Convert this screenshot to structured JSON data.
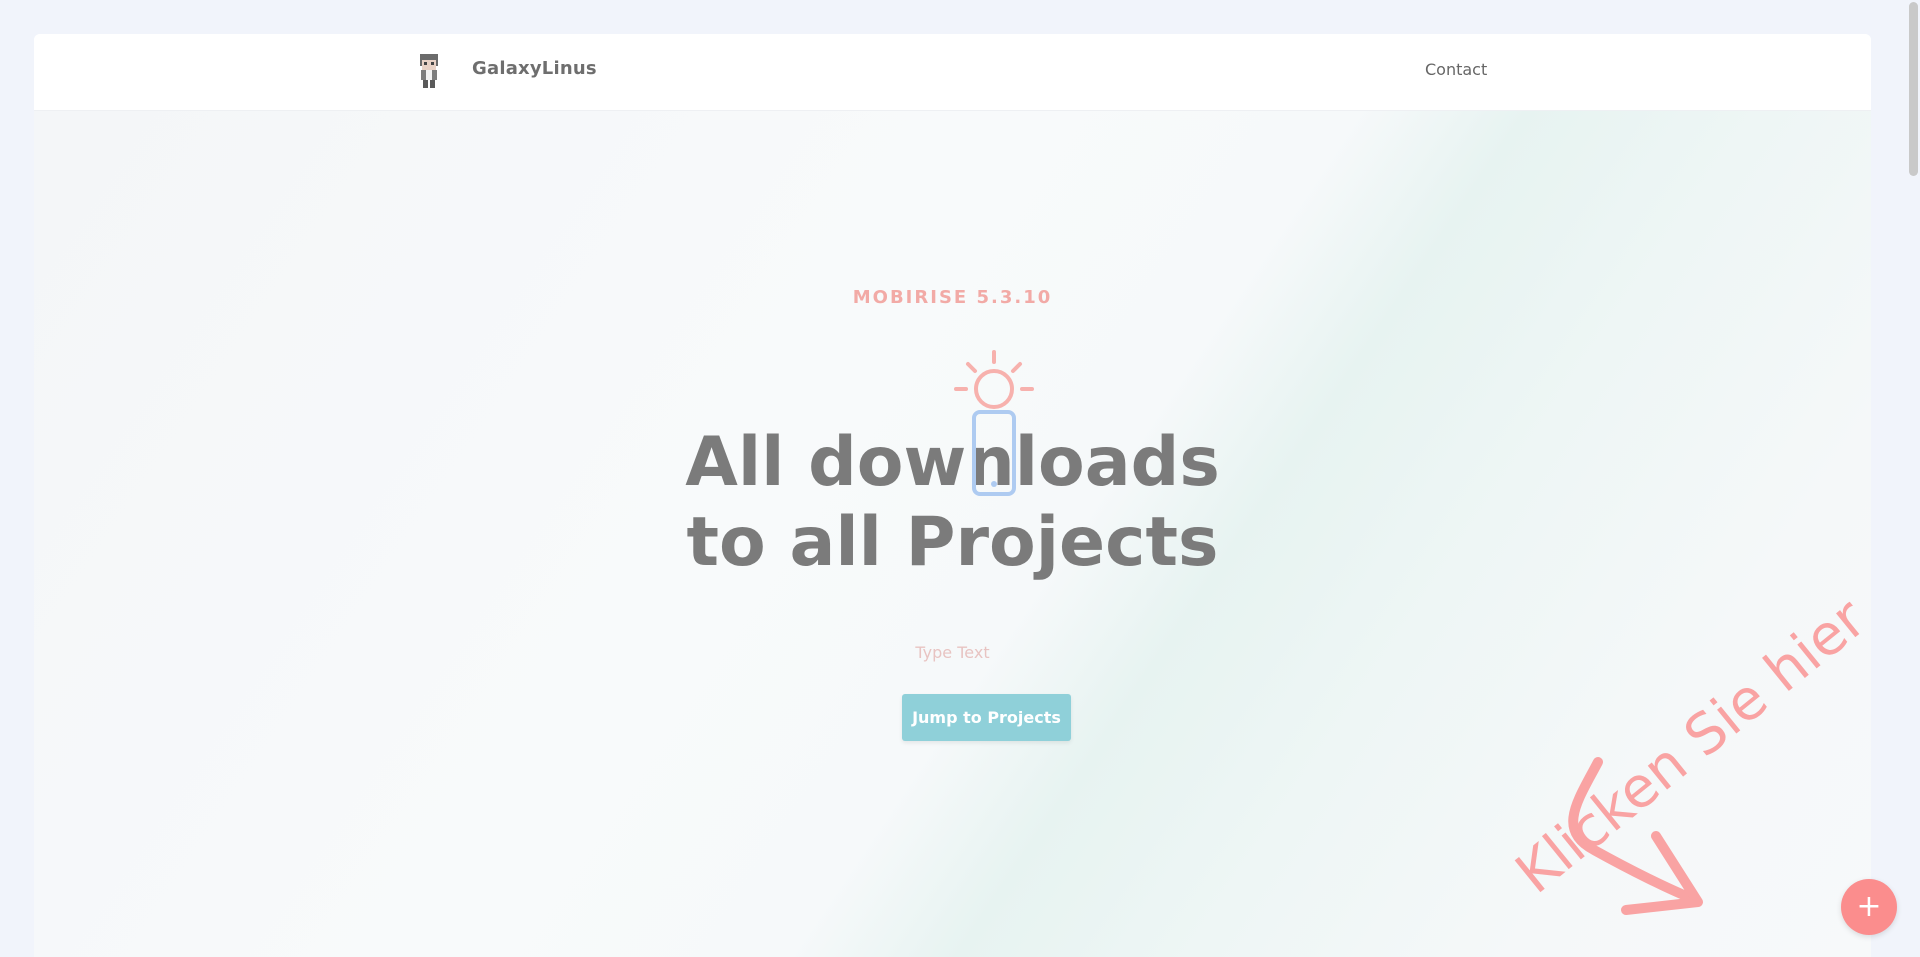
{
  "navbar": {
    "brand_name": "GalaxyLinus",
    "brand_logo_icon": "pixel-avatar-icon",
    "links": [
      "Contact"
    ]
  },
  "hero": {
    "tag": "MOBIRISE  5.3.10",
    "title_line1": "All downloads",
    "title_line2": "to all Projects",
    "subtitle": "Type Text",
    "button_label": "Jump to Projects",
    "edit_icon": "sun-mobile-edit-icon"
  },
  "hint": {
    "text": "Klicken Sie hier",
    "arrow_icon": "curved-arrow-icon"
  },
  "fab": {
    "label": "+",
    "icon": "plus-icon"
  },
  "colors": {
    "accent": "#fb8d8d",
    "button": "#8fd0d9",
    "tag": "#f2aaa6",
    "title": "#7b7b7b"
  }
}
